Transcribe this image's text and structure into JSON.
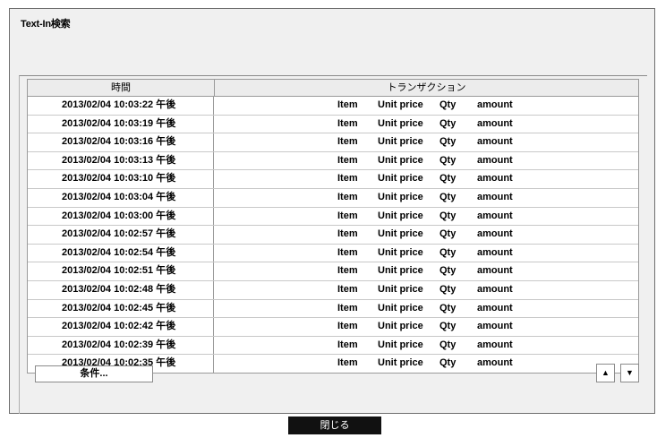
{
  "title": "Text-In検索",
  "columns": {
    "time": "時間",
    "transaction": "トランザクション"
  },
  "rows": [
    {
      "time": "2013/02/04  10:03:22 午後",
      "item": "Item",
      "unit_price": "Unit price",
      "qty": "Qty",
      "amount": "amount"
    },
    {
      "time": "2013/02/04  10:03:19 午後",
      "item": "Item",
      "unit_price": "Unit price",
      "qty": "Qty",
      "amount": "amount"
    },
    {
      "time": "2013/02/04  10:03:16 午後",
      "item": "Item",
      "unit_price": "Unit price",
      "qty": "Qty",
      "amount": "amount"
    },
    {
      "time": "2013/02/04  10:03:13 午後",
      "item": "Item",
      "unit_price": "Unit price",
      "qty": "Qty",
      "amount": "amount"
    },
    {
      "time": "2013/02/04  10:03:10 午後",
      "item": "Item",
      "unit_price": "Unit price",
      "qty": "Qty",
      "amount": "amount"
    },
    {
      "time": "2013/02/04  10:03:04 午後",
      "item": "Item",
      "unit_price": "Unit price",
      "qty": "Qty",
      "amount": "amount"
    },
    {
      "time": "2013/02/04  10:03:00 午後",
      "item": "Item",
      "unit_price": "Unit price",
      "qty": "Qty",
      "amount": "amount"
    },
    {
      "time": "2013/02/04  10:02:57 午後",
      "item": "Item",
      "unit_price": "Unit price",
      "qty": "Qty",
      "amount": "amount"
    },
    {
      "time": "2013/02/04  10:02:54 午後",
      "item": "Item",
      "unit_price": "Unit price",
      "qty": "Qty",
      "amount": "amount"
    },
    {
      "time": "2013/02/04  10:02:51 午後",
      "item": "Item",
      "unit_price": "Unit price",
      "qty": "Qty",
      "amount": "amount"
    },
    {
      "time": "2013/02/04  10:02:48 午後",
      "item": "Item",
      "unit_price": "Unit price",
      "qty": "Qty",
      "amount": "amount"
    },
    {
      "time": "2013/02/04  10:02:45 午後",
      "item": "Item",
      "unit_price": "Unit price",
      "qty": "Qty",
      "amount": "amount"
    },
    {
      "time": "2013/02/04  10:02:42 午後",
      "item": "Item",
      "unit_price": "Unit price",
      "qty": "Qty",
      "amount": "amount"
    },
    {
      "time": "2013/02/04  10:02:39 午後",
      "item": "Item",
      "unit_price": "Unit price",
      "qty": "Qty",
      "amount": "amount"
    },
    {
      "time": "2013/02/04  10:02:35 午後",
      "item": "Item",
      "unit_price": "Unit price",
      "qty": "Qty",
      "amount": "amount"
    }
  ],
  "buttons": {
    "condition": "条件...",
    "up_icon": "▲",
    "down_icon": "▼",
    "close": "閉じる"
  },
  "icons": {
    "up": "triangle-up-icon",
    "down": "triangle-down-icon"
  }
}
